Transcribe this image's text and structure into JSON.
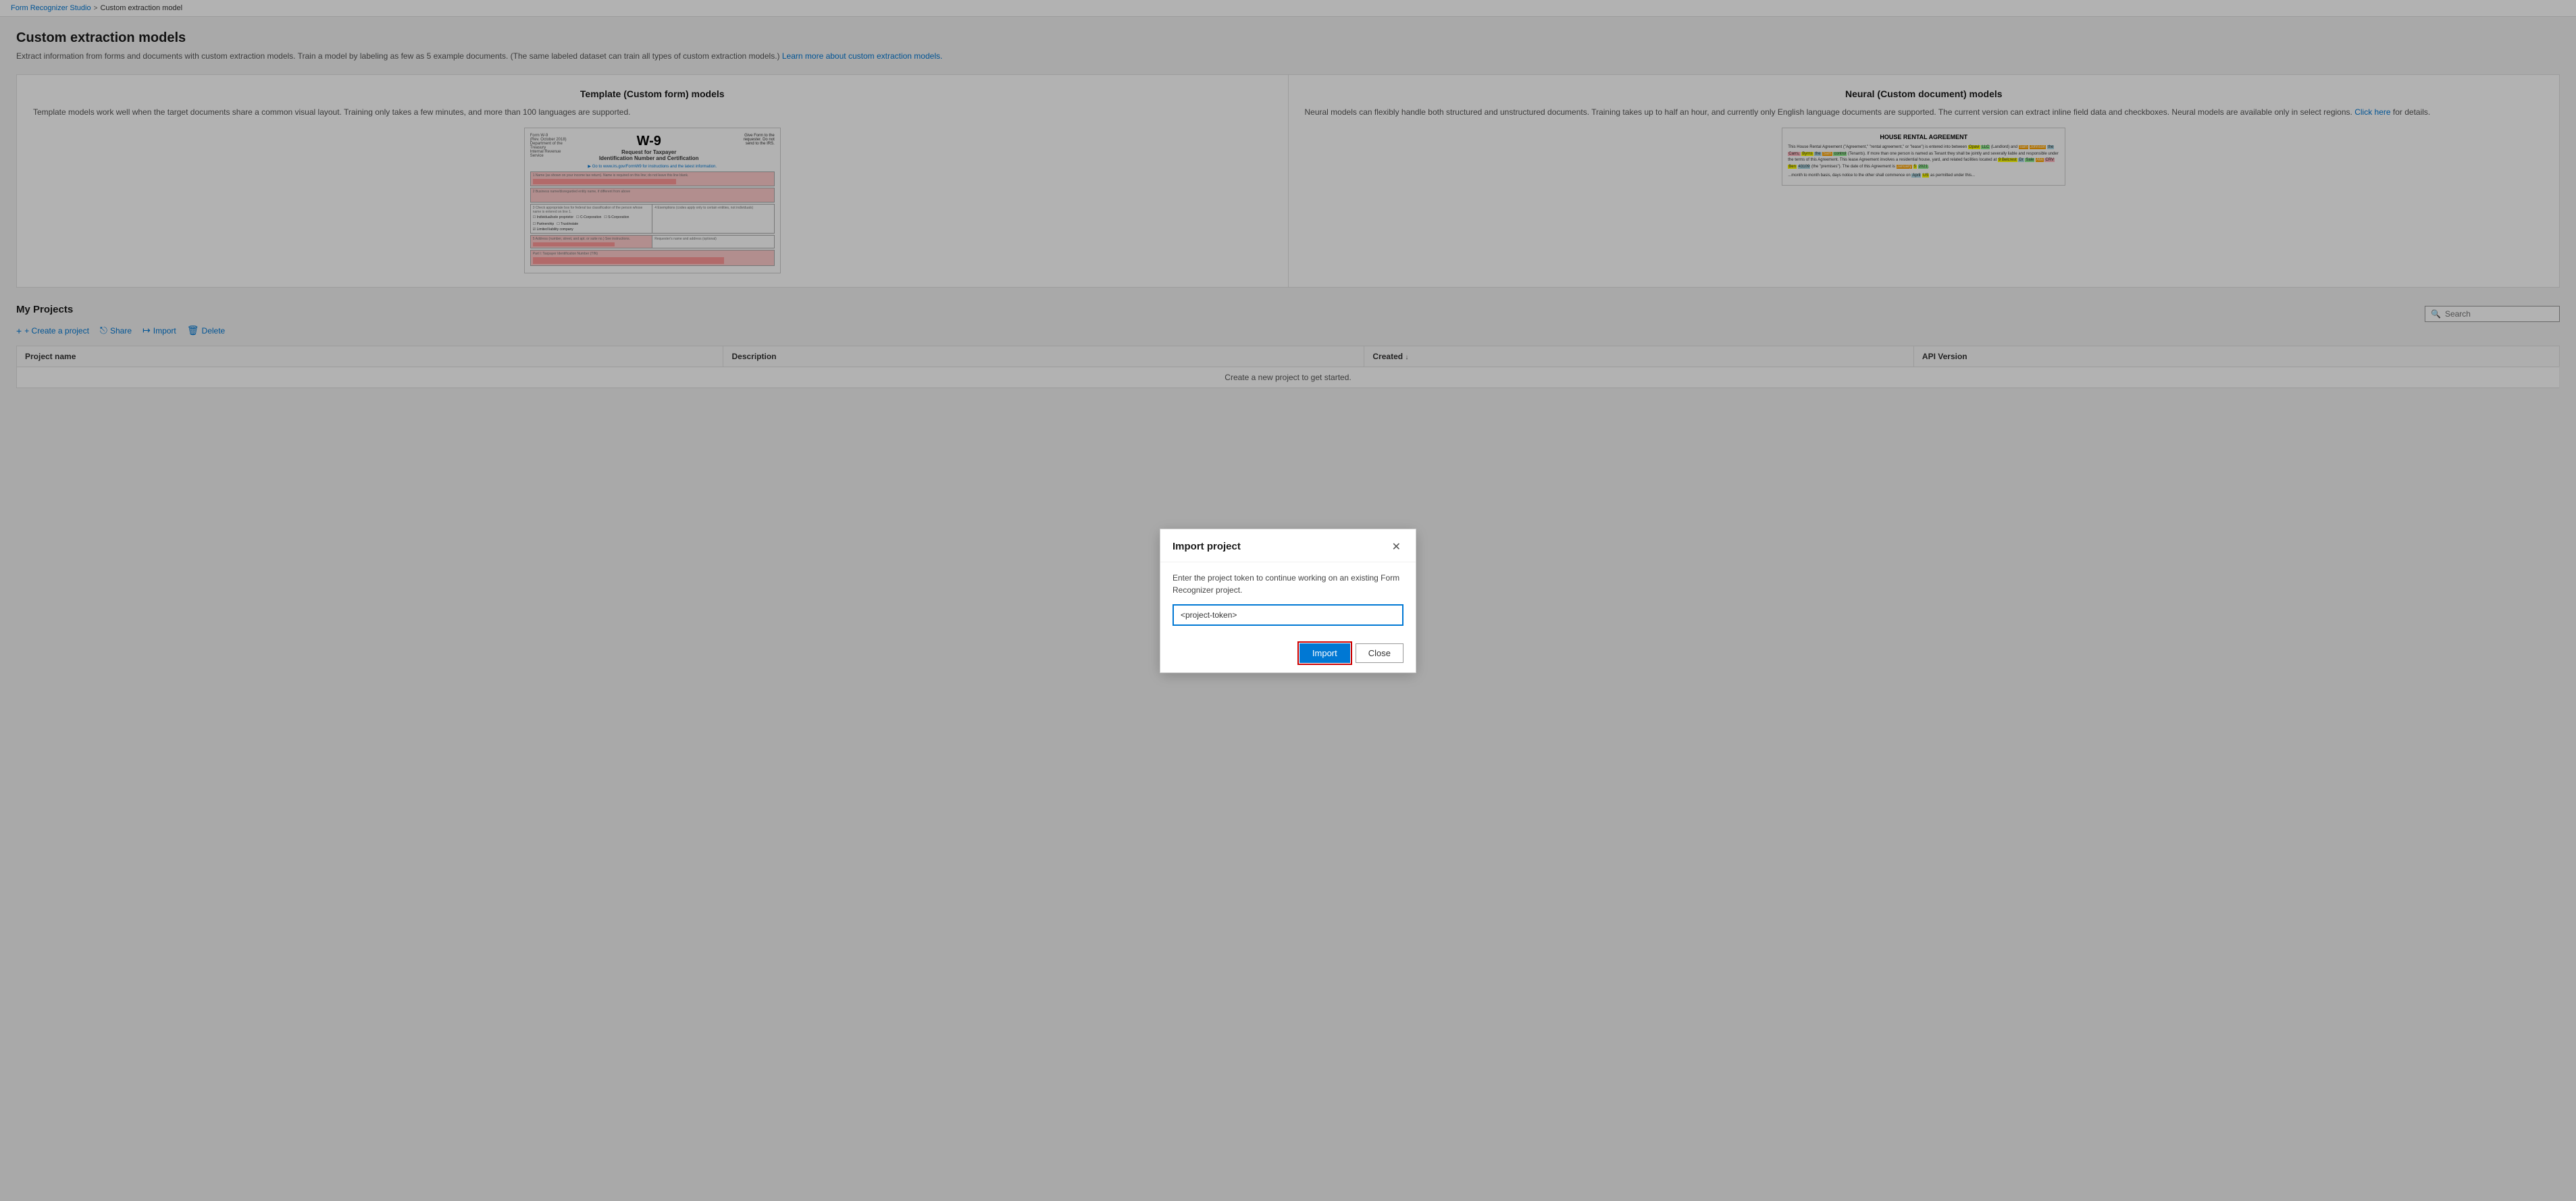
{
  "breadcrumb": {
    "home": "Form Recognizer Studio",
    "separator": ">",
    "current": "Custom extraction model"
  },
  "page": {
    "title": "Custom extraction models",
    "description": "Extract information from forms and documents with custom extraction models. Train a model by labeling as few as 5 example documents. (The same labeled dataset can train all types of custom extraction models.)",
    "description_link_text": "Learn more about custom extraction models.",
    "description_link_href": "#"
  },
  "models": {
    "template": {
      "title": "Template (Custom form) models",
      "description": "Template models work well when the target documents share a common visual layout. Training only takes a few minutes, and more than 100 languages are supported."
    },
    "neural": {
      "title": "Neural (Custom document) models",
      "description": "Neural models can flexibly handle both structured and unstructured documents. Training takes up to half an hour, and currently only English language documents are supported. The current version can extract inline field data and checkboxes. Neural models are available only in select regions.",
      "link_text": "Click here",
      "link_href": "#",
      "description_suffix": "for details."
    }
  },
  "projects": {
    "title": "My Projects",
    "toolbar": {
      "create": "+ Create a project",
      "share": "Share",
      "import": "Import",
      "delete": "Delete"
    },
    "table": {
      "columns": [
        {
          "label": "Project name",
          "sort": false
        },
        {
          "label": "Description",
          "sort": false
        },
        {
          "label": "Created ↓",
          "sort": true
        },
        {
          "label": "API Version",
          "sort": false
        }
      ],
      "rows": []
    },
    "empty_state": "Create a new project to get started.",
    "search_placeholder": "Search"
  },
  "dialog": {
    "title": "Import project",
    "description": "Enter the project token to continue working on an existing Form Recognizer project.",
    "input_placeholder": "<project-token>",
    "input_value": "<project-token>",
    "import_button": "Import",
    "close_button": "Close"
  }
}
